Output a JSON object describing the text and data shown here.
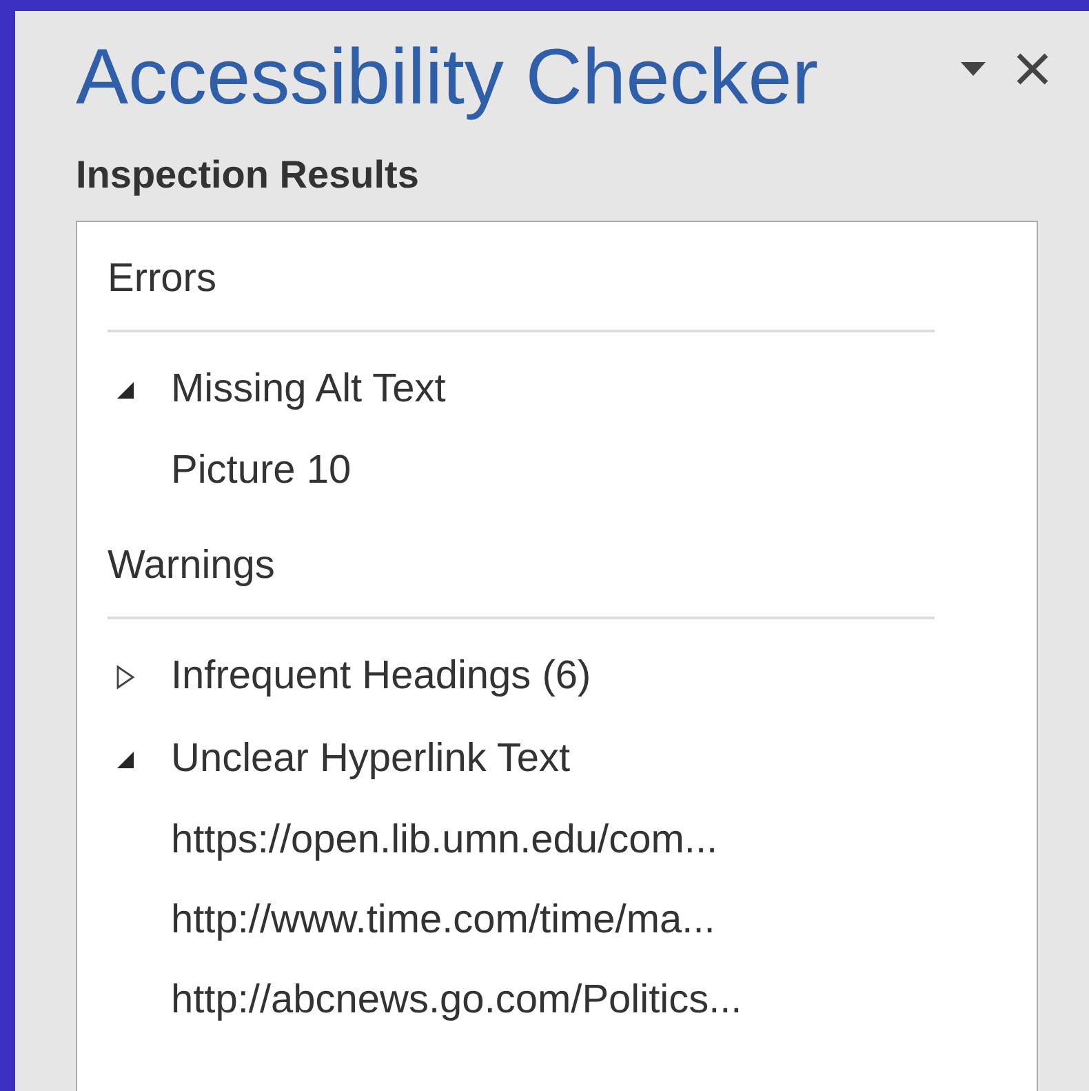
{
  "pane": {
    "title": "Accessibility Checker",
    "subtitle": "Inspection Results"
  },
  "sections": [
    {
      "heading": "Errors",
      "groups": [
        {
          "label": "Missing Alt Text",
          "expanded": true,
          "children": [
            {
              "label": "Picture 10"
            }
          ]
        }
      ]
    },
    {
      "heading": "Warnings",
      "groups": [
        {
          "label": "Infrequent Headings (6)",
          "expanded": false
        },
        {
          "label": "Unclear Hyperlink Text",
          "expanded": true,
          "children": [
            {
              "label": "https://open.lib.umn.edu/com..."
            },
            {
              "label": "http://www.time.com/time/ma..."
            },
            {
              "label": "http://abcnews.go.com/Politics..."
            }
          ]
        }
      ]
    }
  ]
}
